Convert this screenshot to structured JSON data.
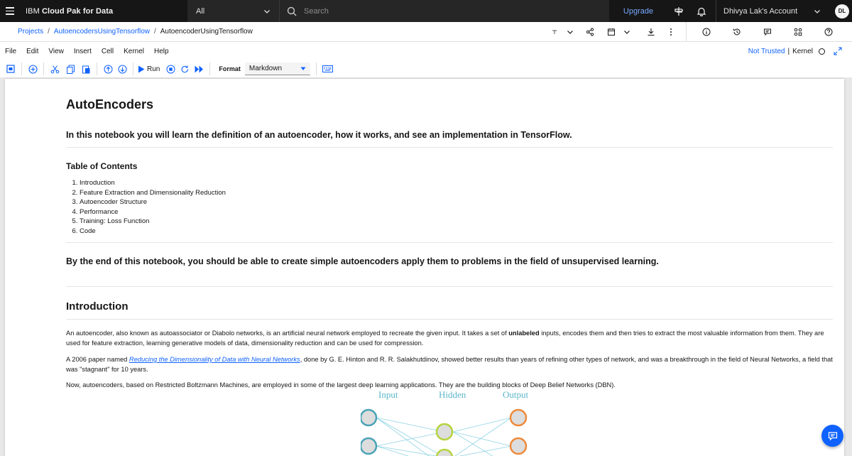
{
  "header": {
    "brand_prefix": "IBM ",
    "brand_name": "Cloud Pak for Data",
    "scope_value": "All",
    "search_placeholder": "Search",
    "upgrade_label": "Upgrade",
    "account_label": "Dhivya Lak's Account",
    "avatar_initials": "DL"
  },
  "breadcrumb": {
    "items": [
      "Projects",
      "AutoencodersUsingTensorflow",
      "AutoencoderUsingTensorflow"
    ],
    "separator": "/"
  },
  "menubar": {
    "items": [
      "File",
      "Edit",
      "View",
      "Insert",
      "Cell",
      "Kernel",
      "Help"
    ],
    "trust_label": "Not Trusted",
    "kernel_label": "Kernel"
  },
  "toolbar": {
    "run_label": "Run",
    "format_label": "Format",
    "format_value": "Markdown"
  },
  "notebook": {
    "title": "AutoEncoders",
    "subtitle": "In this notebook you will learn the definition of an autoencoder, how it works, and see an implementation in TensorFlow.",
    "toc_heading": "Table of Contents",
    "toc_items": [
      "Introduction",
      "Feature Extraction and Dimensionality Reduction",
      "Autoencoder Structure",
      "Performance",
      "Training: Loss Function",
      "Code"
    ],
    "goal": "By the end of this notebook, you should be able to create simple autoencoders apply them to problems in the field of unsupervised learning.",
    "intro_heading": "Introduction",
    "para1_a": "An autoencoder, also known as autoassociator or Diabolo networks, is an artificial neural network employed to recreate the given input. It takes a set of ",
    "para1_bold": "unlabeled",
    "para1_b": " inputs, encodes them and then tries to extract the most valuable information from them. They are used for feature extraction, learning generative models of data, dimensionality reduction and can be used for compression.",
    "para2_a": "A 2006 paper named ",
    "para2_link": "Reducing the Dimensionality of Data with Neural Networks",
    "para2_b": ", done by G. E. Hinton and R. R. Salakhutdinov, showed better results than years of refining other types of network, and was a breakthrough in the field of Neural Networks, a field that was \"stagnant\" for 10 years.",
    "para3": "Now, autoencoders, based on Restricted Boltzmann Machines, are employed in some of the largest deep learning applications. They are the building blocks of Deep Belief Networks (DBN).",
    "diagram_labels": [
      "Input",
      "Hidden",
      "Output"
    ]
  }
}
